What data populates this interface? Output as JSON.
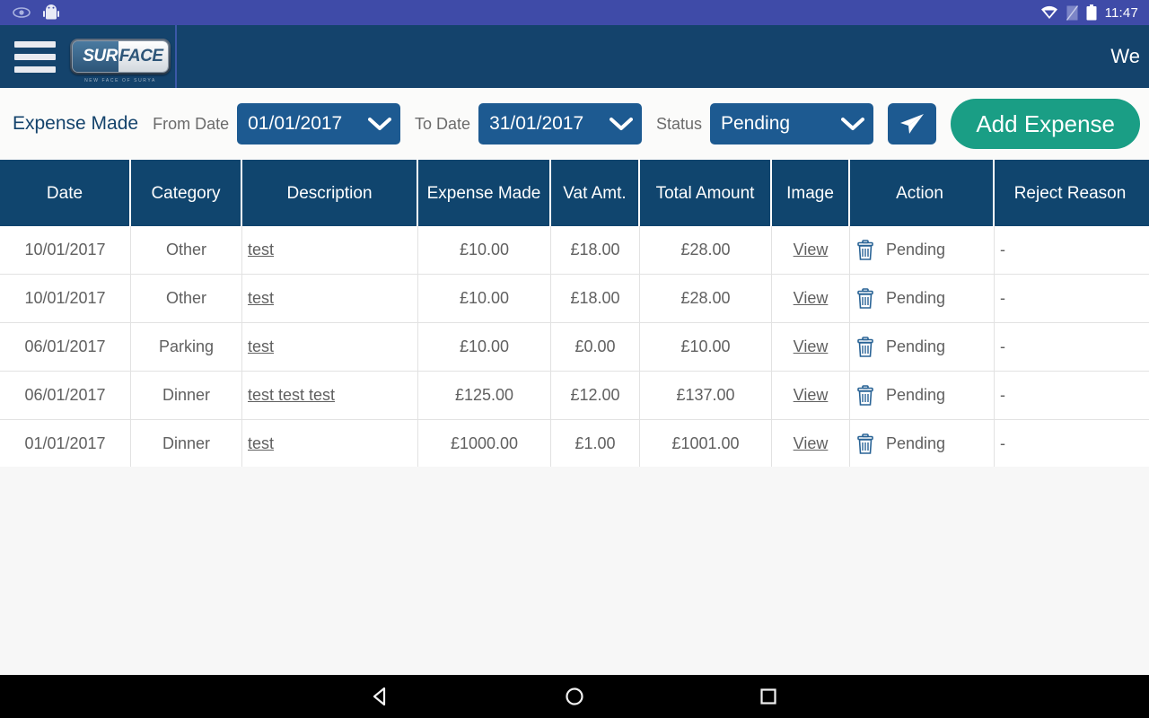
{
  "statusbar": {
    "time": "11:47",
    "icons_left": [
      "eye-icon",
      "android-robot-icon"
    ],
    "icons_right": [
      "wifi-icon",
      "sim-disabled-icon",
      "battery-icon"
    ]
  },
  "header": {
    "menu_icon": "hamburger-icon",
    "logo_sur": "SUR",
    "logo_face": "FACE",
    "logo_tagline": "NEW FACE OF SURYA",
    "user_label": "We"
  },
  "toolbar": {
    "title": "Expense Made",
    "from_date_label": "From Date",
    "from_date_value": "01/01/2017",
    "to_date_label": "To Date",
    "to_date_value": "31/01/2017",
    "status_label": "Status",
    "status_value": "Pending",
    "status_options": [
      "Pending"
    ],
    "send_icon": "send-paper-plane-icon",
    "add_expense_label": "Add Expense",
    "accent_teal": "#1a9e85",
    "accent_blue": "#1d5a91"
  },
  "table": {
    "columns": [
      "Date",
      "Category",
      "Description",
      "Expense Made",
      "Vat Amt.",
      "Total Amount",
      "Image",
      "Action",
      "Reject Reason"
    ],
    "header_bg": "#10456e",
    "rows": [
      {
        "date": "10/01/2017",
        "category": "Other",
        "description": "test",
        "expense_made": "£10.00",
        "vat": "£18.00",
        "total": "£28.00",
        "image": "View",
        "action": "Pending",
        "reject_reason": "-"
      },
      {
        "date": "10/01/2017",
        "category": "Other",
        "description": "test",
        "expense_made": "£10.00",
        "vat": "£18.00",
        "total": "£28.00",
        "image": "View",
        "action": "Pending",
        "reject_reason": "-"
      },
      {
        "date": "06/01/2017",
        "category": "Parking",
        "description": "test",
        "expense_made": "£10.00",
        "vat": "£0.00",
        "total": "£10.00",
        "image": "View",
        "action": "Pending",
        "reject_reason": "-"
      },
      {
        "date": "06/01/2017",
        "category": "Dinner",
        "description": "test test test",
        "expense_made": "£125.00",
        "vat": "£12.00",
        "total": "£137.00",
        "image": "View",
        "action": "Pending",
        "reject_reason": "-"
      },
      {
        "date": "01/01/2017",
        "category": "Dinner",
        "description": "test",
        "expense_made": "£1000.00",
        "vat": "£1.00",
        "total": "£1001.00",
        "image": "View",
        "action": "Pending",
        "reject_reason": "-"
      }
    ],
    "row_delete_icon": "trash-icon"
  },
  "navbar": {
    "back_icon": "back-triangle-icon",
    "home_icon": "home-circle-icon",
    "recents_icon": "recents-square-icon"
  }
}
